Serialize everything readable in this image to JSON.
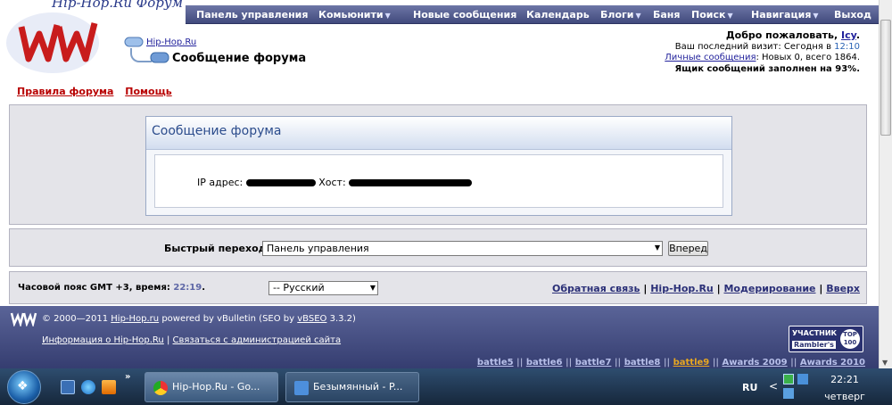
{
  "forum": {
    "title": "Hip-Hop.Ru Форум"
  },
  "nav": {
    "items": [
      {
        "label": "Панель управления"
      },
      {
        "label": "Комьюнити"
      },
      {
        "label": "Новые сообщения"
      },
      {
        "label": "Календарь"
      },
      {
        "label": "Блоги"
      },
      {
        "label": "Баня"
      },
      {
        "label": "Поиск"
      },
      {
        "label": "Навигация"
      },
      {
        "label": "Выход"
      }
    ]
  },
  "breadcrumb": {
    "root": "Hip-Hop.Ru",
    "current": "Сообщение форума"
  },
  "user": {
    "welcome_prefix": "Добро пожаловать,",
    "username": "Icy",
    "welcome_suffix": ".",
    "last_visit_prefix": "Ваш последний визит: Сегодня в",
    "last_visit_time": "12:10",
    "pm_link": "Личные сообщения",
    "pm_stats": ": Новых 0, всего 1864.",
    "mailbox_full": "Ящик сообщений заполнен на 93%."
  },
  "toplinks": {
    "rules": "Правила форума",
    "help": "Помощь"
  },
  "message": {
    "title": "Сообщение форума",
    "ip_label": "IP адрес:",
    "host_label": "Хост:"
  },
  "jump": {
    "label": "Быстрый переход",
    "selected": "Панель управления",
    "go_button": "Вперед"
  },
  "timezone": {
    "prefix": "Часовой пояс GMT +3, время:",
    "time": "22:19",
    "suffix": "."
  },
  "language": {
    "selected": "-- Русский"
  },
  "footer_links": {
    "feedback": "Обратная связь",
    "site": "Hip-Hop.Ru",
    "moderation": "Модерирование",
    "top": "Вверх",
    "separator": "|"
  },
  "footer": {
    "copyright_prefix": "© 2000—2011",
    "copyright_site": "Hip-Hop.ru",
    "powered": "powered by vBulletin (SEO by",
    "vbseo": "vBSEO",
    "vbseo_version": "3.3.2)",
    "info_link": "Информация о Hip-Hop.Ru",
    "info_sep": "|",
    "contact_link": "Связаться с администрацией сайта",
    "badge_top": "УЧАСТНИК",
    "badge_bottom": "Rambler's",
    "badge_circle_top": "TOP",
    "badge_circle_bottom": "100"
  },
  "battles": {
    "items": [
      {
        "label": "battle5"
      },
      {
        "label": "battle6"
      },
      {
        "label": "battle7"
      },
      {
        "label": "battle8"
      },
      {
        "label": "battle9"
      },
      {
        "label": "Awards 2009"
      },
      {
        "label": "Awards 2010"
      }
    ],
    "separator": "||"
  },
  "taskbar": {
    "tasks": [
      {
        "label": "Hip-Hop.Ru - Go..."
      },
      {
        "label": "Безымянный - P..."
      }
    ],
    "overflow": "»",
    "lang": "RU",
    "tray_arrow": "<",
    "time": "22:21",
    "day": "четверг"
  },
  "colors": {
    "nav_bg": "#414a7d",
    "footer_bg": "#353d70",
    "link_red": "#b80000",
    "link_blue": "#22229c",
    "highlight": "#e8a820"
  },
  "icons": {
    "start": "windows-start-icon",
    "show_desktop": "show-desktop-icon",
    "ie": "internet-explorer-icon",
    "media_player": "media-player-icon",
    "chrome": "chrome-icon",
    "paint": "paint-icon"
  }
}
